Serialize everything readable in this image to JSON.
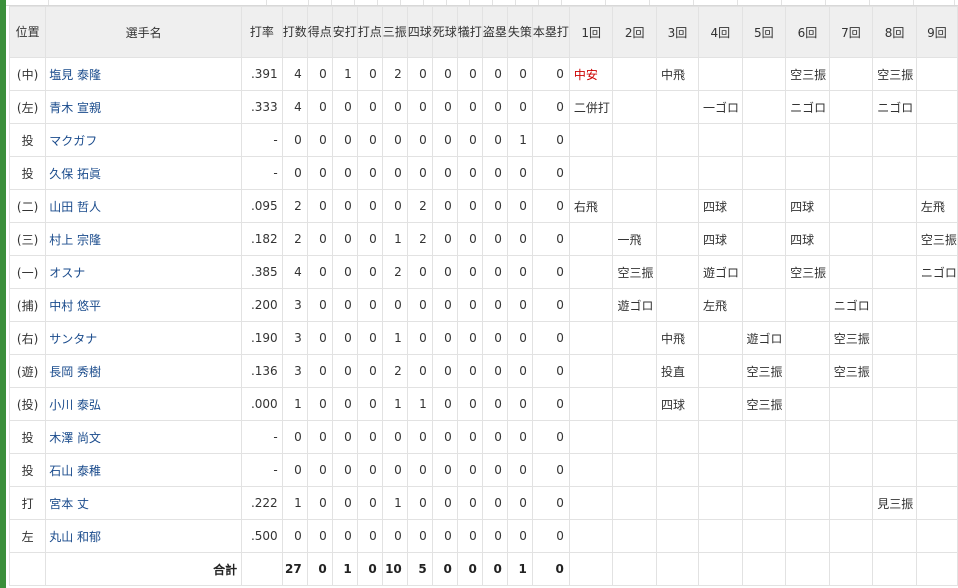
{
  "header": {
    "pos": "位置",
    "name": "選手名",
    "stats": [
      "打率",
      "打数",
      "得点",
      "安打",
      "打点",
      "三振",
      "四球",
      "死球",
      "犠打",
      "盗塁",
      "失策",
      "本塁打"
    ],
    "innings": [
      "1回",
      "2回",
      "3回",
      "4回",
      "5回",
      "6回",
      "7回",
      "8回",
      "9回"
    ]
  },
  "colors": {
    "accent_bar": "#3a8f3a",
    "header_bg": "#efefef",
    "name_link": "#1a4b8c",
    "hit_text": "#cc0000"
  },
  "players": [
    {
      "pos": "(中)",
      "name": "塩見 泰隆",
      "avg": ".391",
      "ab": "4",
      "r": "0",
      "h": "1",
      "rbi": "0",
      "so": "2",
      "bb": "0",
      "hbp": "0",
      "sac": "0",
      "sb": "0",
      "e": "0",
      "hr": "0",
      "innings": [
        "中安",
        "",
        "中飛",
        "",
        "",
        "空三振",
        "",
        "空三振",
        ""
      ],
      "hit_innings": [
        0
      ]
    },
    {
      "pos": "(左)",
      "name": "青木 宣親",
      "avg": ".333",
      "ab": "4",
      "r": "0",
      "h": "0",
      "rbi": "0",
      "so": "0",
      "bb": "0",
      "hbp": "0",
      "sac": "0",
      "sb": "0",
      "e": "0",
      "hr": "0",
      "innings": [
        "二併打",
        "",
        "",
        "一ゴロ",
        "",
        "ニゴロ",
        "",
        "ニゴロ",
        ""
      ]
    },
    {
      "pos": "投",
      "name": "マクガフ",
      "avg": "-",
      "ab": "0",
      "r": "0",
      "h": "0",
      "rbi": "0",
      "so": "0",
      "bb": "0",
      "hbp": "0",
      "sac": "0",
      "sb": "0",
      "e": "1",
      "hr": "0",
      "innings": [
        "",
        "",
        "",
        "",
        "",
        "",
        "",
        "",
        ""
      ]
    },
    {
      "pos": "投",
      "name": "久保 拓眞",
      "avg": "-",
      "ab": "0",
      "r": "0",
      "h": "0",
      "rbi": "0",
      "so": "0",
      "bb": "0",
      "hbp": "0",
      "sac": "0",
      "sb": "0",
      "e": "0",
      "hr": "0",
      "innings": [
        "",
        "",
        "",
        "",
        "",
        "",
        "",
        "",
        ""
      ]
    },
    {
      "pos": "(二)",
      "name": "山田 哲人",
      "avg": ".095",
      "ab": "2",
      "r": "0",
      "h": "0",
      "rbi": "0",
      "so": "0",
      "bb": "2",
      "hbp": "0",
      "sac": "0",
      "sb": "0",
      "e": "0",
      "hr": "0",
      "innings": [
        "右飛",
        "",
        "",
        "四球",
        "",
        "四球",
        "",
        "",
        "左飛"
      ]
    },
    {
      "pos": "(三)",
      "name": "村上 宗隆",
      "avg": ".182",
      "ab": "2",
      "r": "0",
      "h": "0",
      "rbi": "0",
      "so": "1",
      "bb": "2",
      "hbp": "0",
      "sac": "0",
      "sb": "0",
      "e": "0",
      "hr": "0",
      "innings": [
        "",
        "一飛",
        "",
        "四球",
        "",
        "四球",
        "",
        "",
        "空三振"
      ]
    },
    {
      "pos": "(一)",
      "name": "オスナ",
      "avg": ".385",
      "ab": "4",
      "r": "0",
      "h": "0",
      "rbi": "0",
      "so": "2",
      "bb": "0",
      "hbp": "0",
      "sac": "0",
      "sb": "0",
      "e": "0",
      "hr": "0",
      "innings": [
        "",
        "空三振",
        "",
        "遊ゴロ",
        "",
        "空三振",
        "",
        "",
        "ニゴロ"
      ]
    },
    {
      "pos": "(捕)",
      "name": "中村 悠平",
      "avg": ".200",
      "ab": "3",
      "r": "0",
      "h": "0",
      "rbi": "0",
      "so": "0",
      "bb": "0",
      "hbp": "0",
      "sac": "0",
      "sb": "0",
      "e": "0",
      "hr": "0",
      "innings": [
        "",
        "遊ゴロ",
        "",
        "左飛",
        "",
        "",
        "ニゴロ",
        "",
        ""
      ]
    },
    {
      "pos": "(右)",
      "name": "サンタナ",
      "avg": ".190",
      "ab": "3",
      "r": "0",
      "h": "0",
      "rbi": "0",
      "so": "1",
      "bb": "0",
      "hbp": "0",
      "sac": "0",
      "sb": "0",
      "e": "0",
      "hr": "0",
      "innings": [
        "",
        "",
        "中飛",
        "",
        "遊ゴロ",
        "",
        "空三振",
        "",
        ""
      ]
    },
    {
      "pos": "(遊)",
      "name": "長岡 秀樹",
      "avg": ".136",
      "ab": "3",
      "r": "0",
      "h": "0",
      "rbi": "0",
      "so": "2",
      "bb": "0",
      "hbp": "0",
      "sac": "0",
      "sb": "0",
      "e": "0",
      "hr": "0",
      "innings": [
        "",
        "",
        "投直",
        "",
        "空三振",
        "",
        "空三振",
        "",
        ""
      ]
    },
    {
      "pos": "(投)",
      "name": "小川 泰弘",
      "avg": ".000",
      "ab": "1",
      "r": "0",
      "h": "0",
      "rbi": "0",
      "so": "1",
      "bb": "1",
      "hbp": "0",
      "sac": "0",
      "sb": "0",
      "e": "0",
      "hr": "0",
      "innings": [
        "",
        "",
        "四球",
        "",
        "空三振",
        "",
        "",
        "",
        ""
      ]
    },
    {
      "pos": "投",
      "name": "木澤 尚文",
      "avg": "-",
      "ab": "0",
      "r": "0",
      "h": "0",
      "rbi": "0",
      "so": "0",
      "bb": "0",
      "hbp": "0",
      "sac": "0",
      "sb": "0",
      "e": "0",
      "hr": "0",
      "innings": [
        "",
        "",
        "",
        "",
        "",
        "",
        "",
        "",
        ""
      ]
    },
    {
      "pos": "投",
      "name": "石山 泰稚",
      "avg": "-",
      "ab": "0",
      "r": "0",
      "h": "0",
      "rbi": "0",
      "so": "0",
      "bb": "0",
      "hbp": "0",
      "sac": "0",
      "sb": "0",
      "e": "0",
      "hr": "0",
      "innings": [
        "",
        "",
        "",
        "",
        "",
        "",
        "",
        "",
        ""
      ]
    },
    {
      "pos": "打",
      "name": "宮本 丈",
      "avg": ".222",
      "ab": "1",
      "r": "0",
      "h": "0",
      "rbi": "0",
      "so": "1",
      "bb": "0",
      "hbp": "0",
      "sac": "0",
      "sb": "0",
      "e": "0",
      "hr": "0",
      "innings": [
        "",
        "",
        "",
        "",
        "",
        "",
        "",
        "見三振",
        ""
      ]
    },
    {
      "pos": "左",
      "name": "丸山 和郁",
      "avg": ".500",
      "ab": "0",
      "r": "0",
      "h": "0",
      "rbi": "0",
      "so": "0",
      "bb": "0",
      "hbp": "0",
      "sac": "0",
      "sb": "0",
      "e": "0",
      "hr": "0",
      "innings": [
        "",
        "",
        "",
        "",
        "",
        "",
        "",
        "",
        ""
      ]
    }
  ],
  "totals": {
    "label": "合計",
    "ab": "27",
    "r": "0",
    "h": "1",
    "rbi": "0",
    "so": "10",
    "bb": "5",
    "hbp": "0",
    "sac": "0",
    "sb": "0",
    "e": "1",
    "hr": "0"
  }
}
